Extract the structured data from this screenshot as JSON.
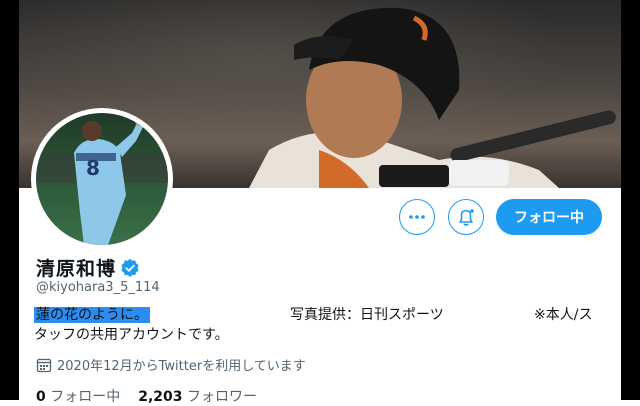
{
  "profile": {
    "display_name": "清原和博",
    "handle": "@kiyohara3_5_114",
    "bio_highlight": "蓮の花のように。",
    "bio_credit": "写真提供：日刊スポーツ",
    "bio_note": "※本人/ス",
    "bio_line2": "タッフの共用アカウントです。",
    "joined": "2020年12月からTwitterを利用しています",
    "following_count": "0",
    "following_label": "フォロー中",
    "followers_count": "2,203",
    "followers_label": "フォロワー"
  },
  "actions": {
    "follow_label": "フォロー中"
  },
  "icons": [
    "more-icon",
    "notification-bell-icon",
    "verified-badge-icon",
    "calendar-icon"
  ],
  "colors": {
    "accent": "#1d9bf0",
    "secondary_text": "#536471",
    "highlight": "#2d8cf0"
  }
}
